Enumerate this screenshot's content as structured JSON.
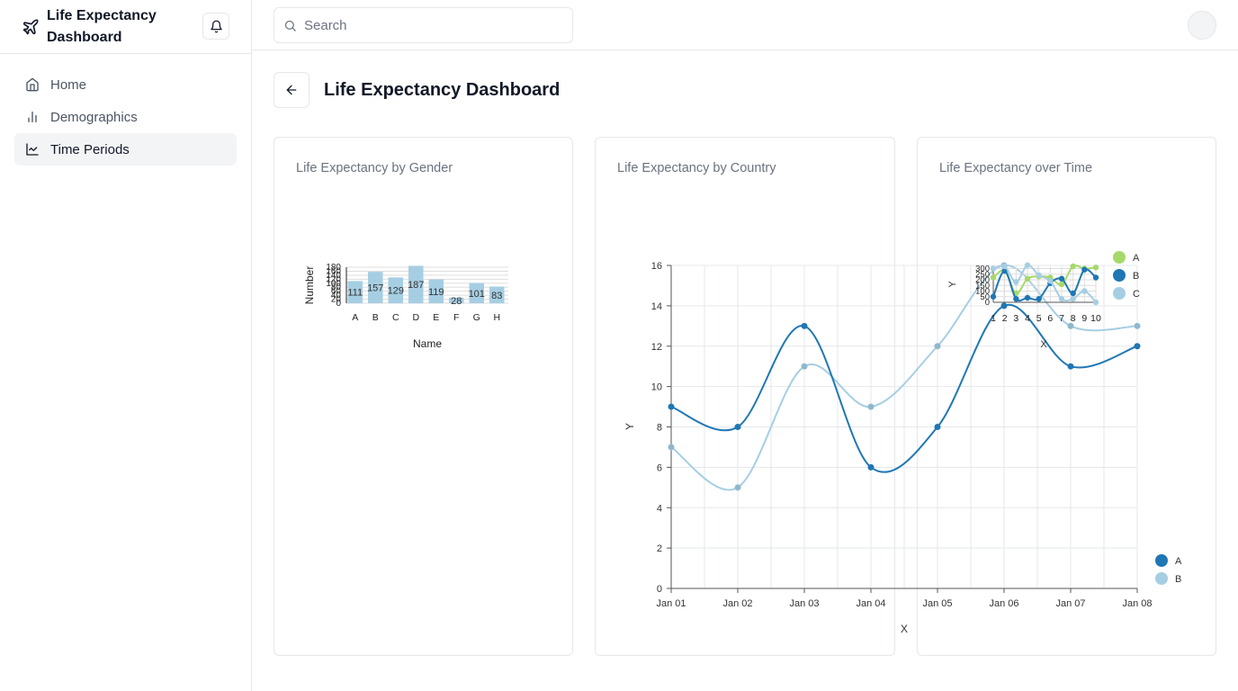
{
  "brand": {
    "title": "Life Expectancy Dashboard",
    "icon": "plane-icon"
  },
  "sidebar": {
    "items": [
      {
        "label": "Home",
        "icon": "home-icon",
        "active": false
      },
      {
        "label": "Demographics",
        "icon": "bar-chart-icon",
        "active": false
      },
      {
        "label": "Time Periods",
        "icon": "line-chart-icon",
        "active": true
      }
    ]
  },
  "search": {
    "placeholder": "Search"
  },
  "page": {
    "title": "Life Expectancy Dashboard"
  },
  "cards": [
    {
      "title": "Life Expectancy by Gender"
    },
    {
      "title": "Life Expectancy by Country"
    },
    {
      "title": "Life Expectancy over Time"
    }
  ],
  "colors": {
    "dark_blue": "#1f77b4",
    "light_blue": "#a6cee3",
    "light_green": "#a6d96a",
    "grid": "#e5e7eb"
  },
  "chart_data": [
    {
      "type": "bar",
      "categories": [
        "A",
        "B",
        "C",
        "D",
        "E",
        "F",
        "G",
        "H"
      ],
      "values": [
        111,
        157,
        129,
        187,
        119,
        28,
        101,
        83
      ],
      "xlabel": "Name",
      "ylabel": "Number",
      "yticks": [
        "0",
        "20",
        "40",
        "60",
        "80",
        "100",
        "120",
        "140",
        "160",
        "180"
      ],
      "ylim": [
        0,
        180
      ]
    },
    {
      "type": "line",
      "x": [
        "Jan 01",
        "Jan 02",
        "Jan 03",
        "Jan 04",
        "Jan 05",
        "Jan 06",
        "Jan 07",
        "Jan 08"
      ],
      "series": [
        {
          "name": "A",
          "values": [
            9,
            8,
            13,
            6,
            8,
            14,
            11,
            12
          ]
        },
        {
          "name": "B",
          "values": [
            7,
            5,
            11,
            9,
            12,
            16,
            13,
            13
          ]
        }
      ],
      "xlabel": "X",
      "ylabel": "Y",
      "ylim": [
        0,
        16
      ],
      "yticks": [
        "0",
        "2",
        "4",
        "6",
        "8",
        "10",
        "12",
        "14",
        "16"
      ],
      "legend": "bottom-right",
      "grid": true
    },
    {
      "type": "line",
      "x": [
        "1",
        "2",
        "3",
        "4",
        "5",
        "6",
        "7",
        "8",
        "9",
        "10"
      ],
      "series": [
        {
          "name": "A",
          "values": [
            220,
            280,
            80,
            210,
            230,
            220,
            160,
            320,
            300,
            310
          ]
        },
        {
          "name": "B",
          "values": [
            50,
            280,
            30,
            40,
            30,
            170,
            210,
            80,
            290,
            220
          ]
        },
        {
          "name": "C",
          "values": [
            300,
            320,
            180,
            330,
            240,
            190,
            30,
            30,
            100,
            0
          ]
        }
      ],
      "xlabel": "X",
      "ylabel": "Y",
      "yticks": [
        "0",
        "50",
        "100",
        "150",
        "200",
        "250",
        "300"
      ],
      "ylim": [
        0,
        320
      ],
      "legend": "right",
      "grid": true
    }
  ]
}
